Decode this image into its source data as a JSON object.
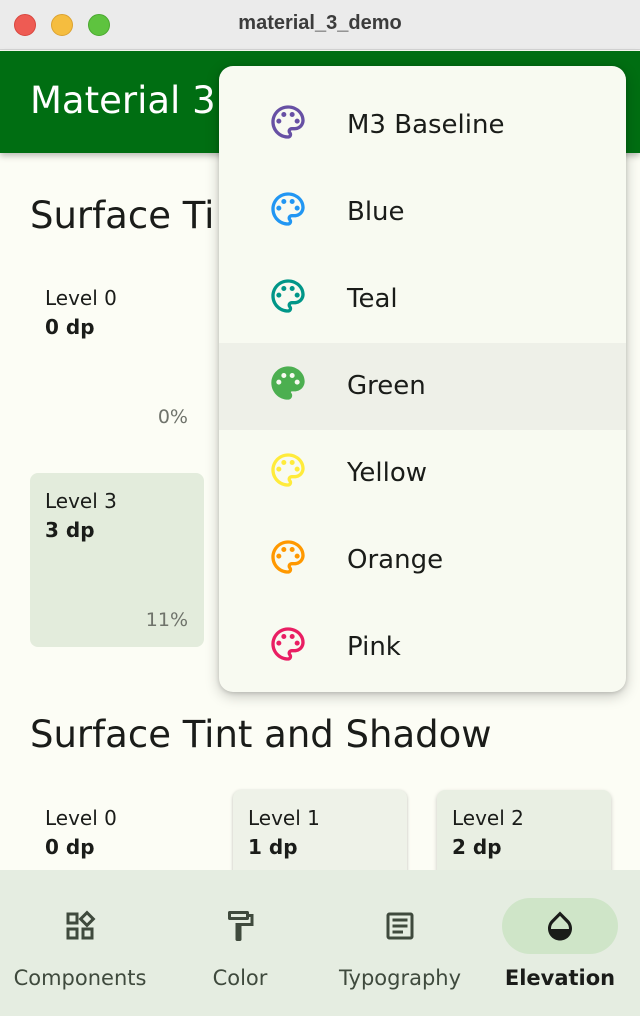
{
  "window": {
    "title": "material_3_demo"
  },
  "appbar": {
    "title": "Material 3"
  },
  "section1": {
    "title": "Surface Ti",
    "cards": [
      {
        "level": "Level 0",
        "dp": "0 dp",
        "pct": "0%"
      },
      {
        "level": "Level 3",
        "dp": "3 dp",
        "pct": "11%"
      }
    ]
  },
  "section2": {
    "title": "Surface Tint and Shadow",
    "cards": [
      {
        "level": "Level 0",
        "dp": "0 dp"
      },
      {
        "level": "Level 1",
        "dp": "1 dp"
      },
      {
        "level": "Level 2",
        "dp": "2 dp"
      }
    ]
  },
  "menu": {
    "items": [
      {
        "label": "M3 Baseline",
        "icon": "palette-icon",
        "color": "#6750a4"
      },
      {
        "label": "Blue",
        "icon": "palette-icon",
        "color": "#2196f3"
      },
      {
        "label": "Teal",
        "icon": "palette-icon",
        "color": "#009688"
      },
      {
        "label": "Green",
        "icon": "palette-icon",
        "color": "#4caf50",
        "highlighted": true
      },
      {
        "label": "Yellow",
        "icon": "palette-icon",
        "color": "#ffeb3b"
      },
      {
        "label": "Orange",
        "icon": "palette-icon",
        "color": "#ff9800"
      },
      {
        "label": "Pink",
        "icon": "palette-icon",
        "color": "#e91e63"
      }
    ]
  },
  "nav": {
    "items": [
      {
        "label": "Components",
        "icon": "widgets-icon"
      },
      {
        "label": "Color",
        "icon": "format-paint-icon"
      },
      {
        "label": "Typography",
        "icon": "article-icon"
      },
      {
        "label": "Elevation",
        "icon": "opacity-icon",
        "selected": true
      }
    ]
  },
  "colors": {
    "primary": "#006e12",
    "surface": "#fcfdf5",
    "nav_bg": "#e5ede1",
    "nav_indicator": "#cfe5c8"
  }
}
